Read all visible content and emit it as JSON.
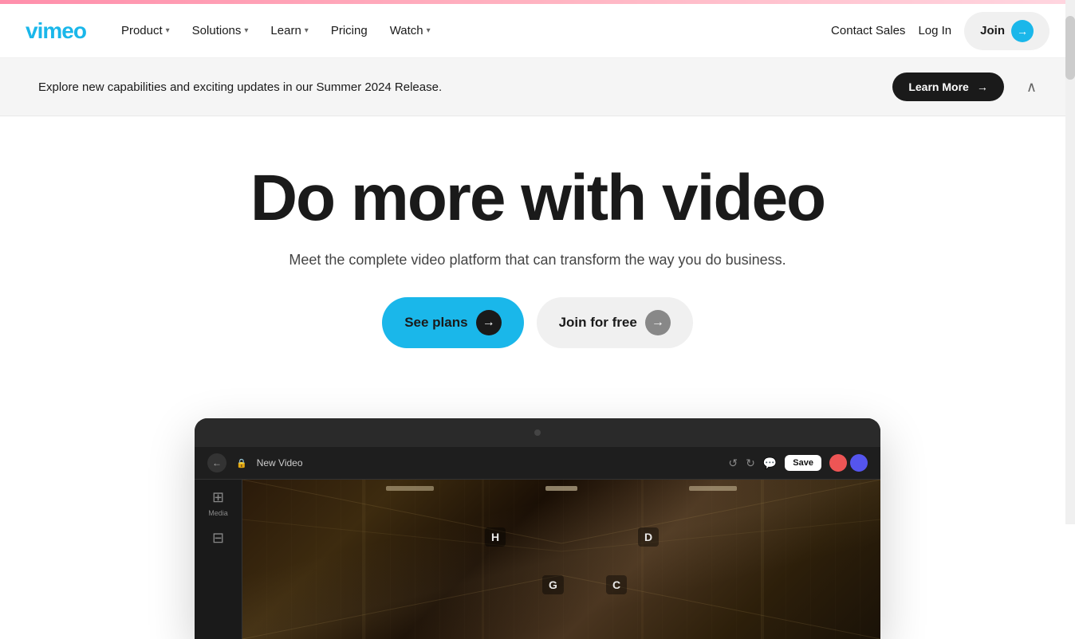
{
  "topbar": {
    "gradient": "pink"
  },
  "navbar": {
    "logo": "vimeo",
    "links": [
      {
        "label": "Product",
        "has_dropdown": true
      },
      {
        "label": "Solutions",
        "has_dropdown": true
      },
      {
        "label": "Learn",
        "has_dropdown": true
      },
      {
        "label": "Pricing",
        "has_dropdown": false
      },
      {
        "label": "Watch",
        "has_dropdown": true
      }
    ],
    "contact_label": "Contact Sales",
    "login_label": "Log In",
    "join_label": "Join",
    "join_arrow": "→"
  },
  "banner": {
    "text": "Explore new capabilities and exciting updates in our Summer 2024 Release.",
    "learn_more_label": "Learn More",
    "close_symbol": "∧"
  },
  "hero": {
    "title": "Do more with video",
    "subtitle": "Meet the complete video platform that can transform the way you do business.",
    "btn_primary_label": "See plans",
    "btn_secondary_label": "Join for free",
    "arrow": "→"
  },
  "app_preview": {
    "video_title": "New Video",
    "save_label": "Save",
    "sidebar_items": [
      {
        "icon": "⊞",
        "label": "Media"
      },
      {
        "icon": "⊟",
        "label": ""
      }
    ],
    "overlay_labels": [
      "H",
      "D",
      "G",
      "C"
    ]
  },
  "colors": {
    "accent": "#1ab7ea",
    "dark": "#1a1a1a",
    "light_bg": "#f0f0f0"
  }
}
